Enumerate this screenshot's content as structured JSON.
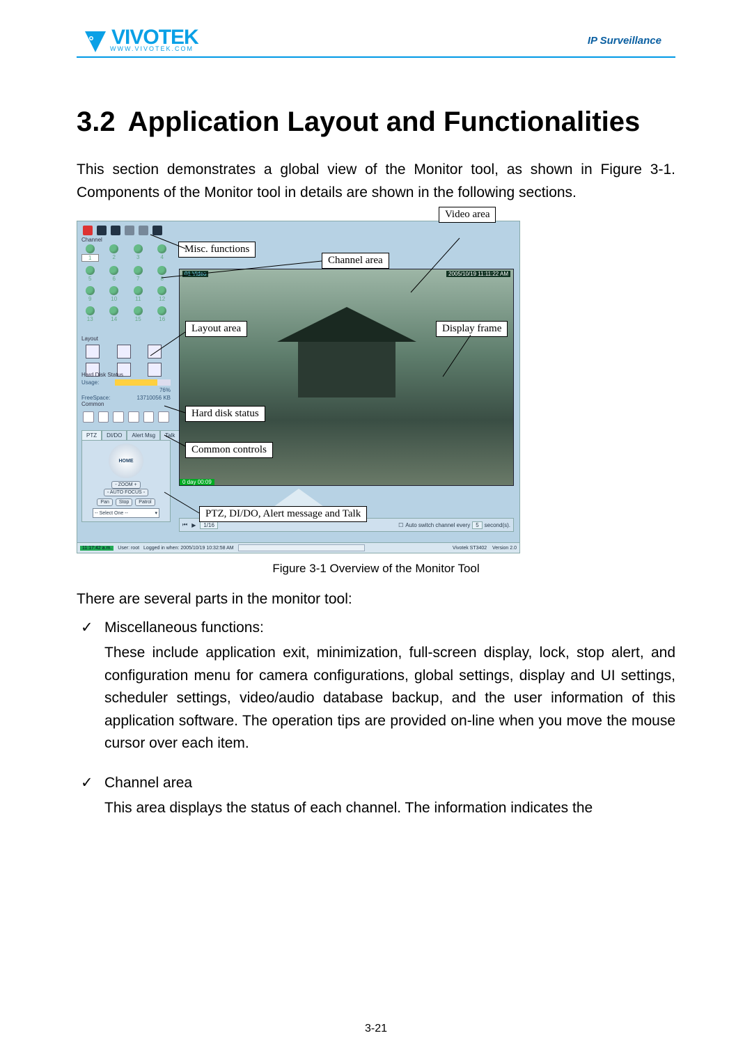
{
  "header": {
    "brand": "VIVOTEK",
    "brand_sub": "WWW.VIVOTEK.COM",
    "tagline": "IP Surveillance"
  },
  "title": {
    "number": "3.2",
    "text": "Application Layout and Functionalities"
  },
  "intro": "This section demonstrates a global view of the Monitor tool, as shown in Figure 3-1. Components of the Monitor tool in details are shown in the following sections.",
  "figure": {
    "caption": "Figure 3-1 Overview of the Monitor Tool",
    "callouts": {
      "misc": "Misc. functions",
      "channel": "Channel area",
      "video": "Video area",
      "layout": "Layout area",
      "display": "Display frame",
      "hdd": "Hard disk status",
      "common": "Common controls",
      "ptz": "PTZ, DI/DO, Alert message and Talk"
    },
    "app": {
      "channel_title": "Channel",
      "channel_numbers": [
        "1",
        "2",
        "3",
        "4",
        "5",
        "6",
        "7",
        "8",
        "9",
        "10",
        "11",
        "12",
        "13",
        "14",
        "15",
        "16"
      ],
      "layout_title": "Layout",
      "hdd": {
        "title": "Hard Disk Status",
        "usage_label": "Usage:",
        "usage_value": "76%",
        "free_label": "FreeSpace:",
        "free_value": "13710056 KB"
      },
      "common_title": "Common",
      "tabs": [
        "PTZ",
        "DI/DO",
        "Alert Msg",
        "Talk"
      ],
      "ptz": {
        "home": "HOME",
        "zoom": "ZOOM",
        "autofocus": "AUTO FOCUS",
        "pan": "Pan",
        "stop": "Stop",
        "patrol": "Patrol",
        "select": "-- Select One --"
      },
      "video": {
        "label": "01 Video",
        "timestamp": "2005/10/19 11:11:22 AM",
        "osd": "0 day  00:09"
      },
      "bottom": {
        "speed": "1/16",
        "autoswitch_label": "Auto switch channel every",
        "autoswitch_value": "5",
        "autoswitch_unit": "second(s)."
      },
      "status": {
        "time": "11:17:42 a.m.",
        "user_label": "User: root",
        "login": "Logged in when: 2005/10/19 10:32:58 AM",
        "product": "Vivotek ST3402",
        "version": "Version 2.0"
      }
    }
  },
  "after_figure": "There are several parts in the monitor tool:",
  "bullets": [
    {
      "lead": "Miscellaneous functions:",
      "desc": "These include application exit, minimization, full-screen display, lock, stop alert, and configuration menu for camera configurations, global settings, display and UI settings, scheduler settings, video/audio database backup, and the user information of this application software. The operation tips are provided on-line when you move the mouse cursor over each item."
    },
    {
      "lead": "Channel area",
      "desc": "This area displays the status of each channel. The information indicates the"
    }
  ],
  "page_number": "3-21"
}
